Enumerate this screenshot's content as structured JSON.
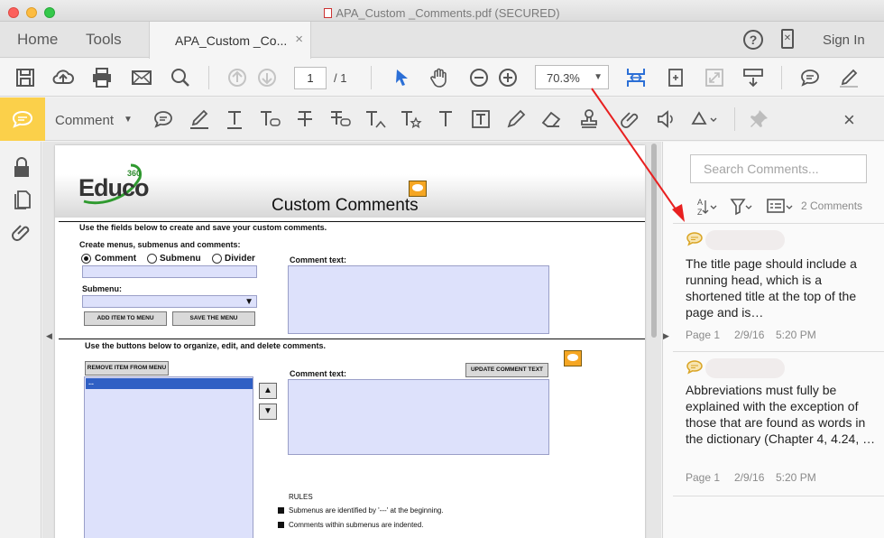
{
  "window": {
    "title": "APA_Custom _Comments.pdf (SECURED)"
  },
  "nav": {
    "home": "Home",
    "tools": "Tools",
    "doc_tab": "APA_Custom _Co...",
    "doc_tab_close": "×",
    "sign_in": "Sign In"
  },
  "toolbar": {
    "page_current": "1",
    "page_total": "/ 1",
    "zoom": "70.3%"
  },
  "comment_toolbar": {
    "label": "Comment",
    "close": "×"
  },
  "document": {
    "logo_text": "Educo",
    "logo_sup": "360",
    "title": "Custom Comments",
    "line1": "Use the fields below to create and save your custom comments.",
    "line2": "Create menus, submenus and comments:",
    "radio_comment": "Comment",
    "radio_submenu": "Submenu",
    "radio_divider": "Divider",
    "comment_text_label_1": "Comment text:",
    "submenu_label": "Submenu:",
    "btn_add_item": "ADD ITEM TO MENU",
    "btn_save_menu": "SAVE THE MENU",
    "line3": "Use the buttons below to organize, edit, and delete comments.",
    "btn_remove": "REMOVE ITEM FROM MENU",
    "btn_update": "UPDATE COMMENT TEXT",
    "comment_text_label_2": "Comment text:",
    "list_selected": "--",
    "rules_title": "RULES",
    "rule1": "Submenus are identified by '---' at the beginning.",
    "rule2": "Comments within submenus are indented."
  },
  "comments_pane": {
    "search_placeholder": "Search Comments...",
    "count": "2 Comments",
    "comments": [
      {
        "text": "The title page should include a running head, which is a shortened title at the top of the page and is…",
        "page": "Page 1",
        "date": "2/9/16",
        "time": "5:20 PM"
      },
      {
        "text": "Abbreviations must fully be explained with the exception of those that are found as words in the dictionary (Chapter 4, 4.24, …",
        "page": "Page 1",
        "date": "2/9/16",
        "time": "5:20 PM"
      }
    ]
  },
  "colors": {
    "accent_yellow": "#fbd04a",
    "note_orange": "#f5a623",
    "selection_blue": "#2f5fc4",
    "field_fill": "#dde1fb",
    "annotation_red": "#e82020"
  }
}
